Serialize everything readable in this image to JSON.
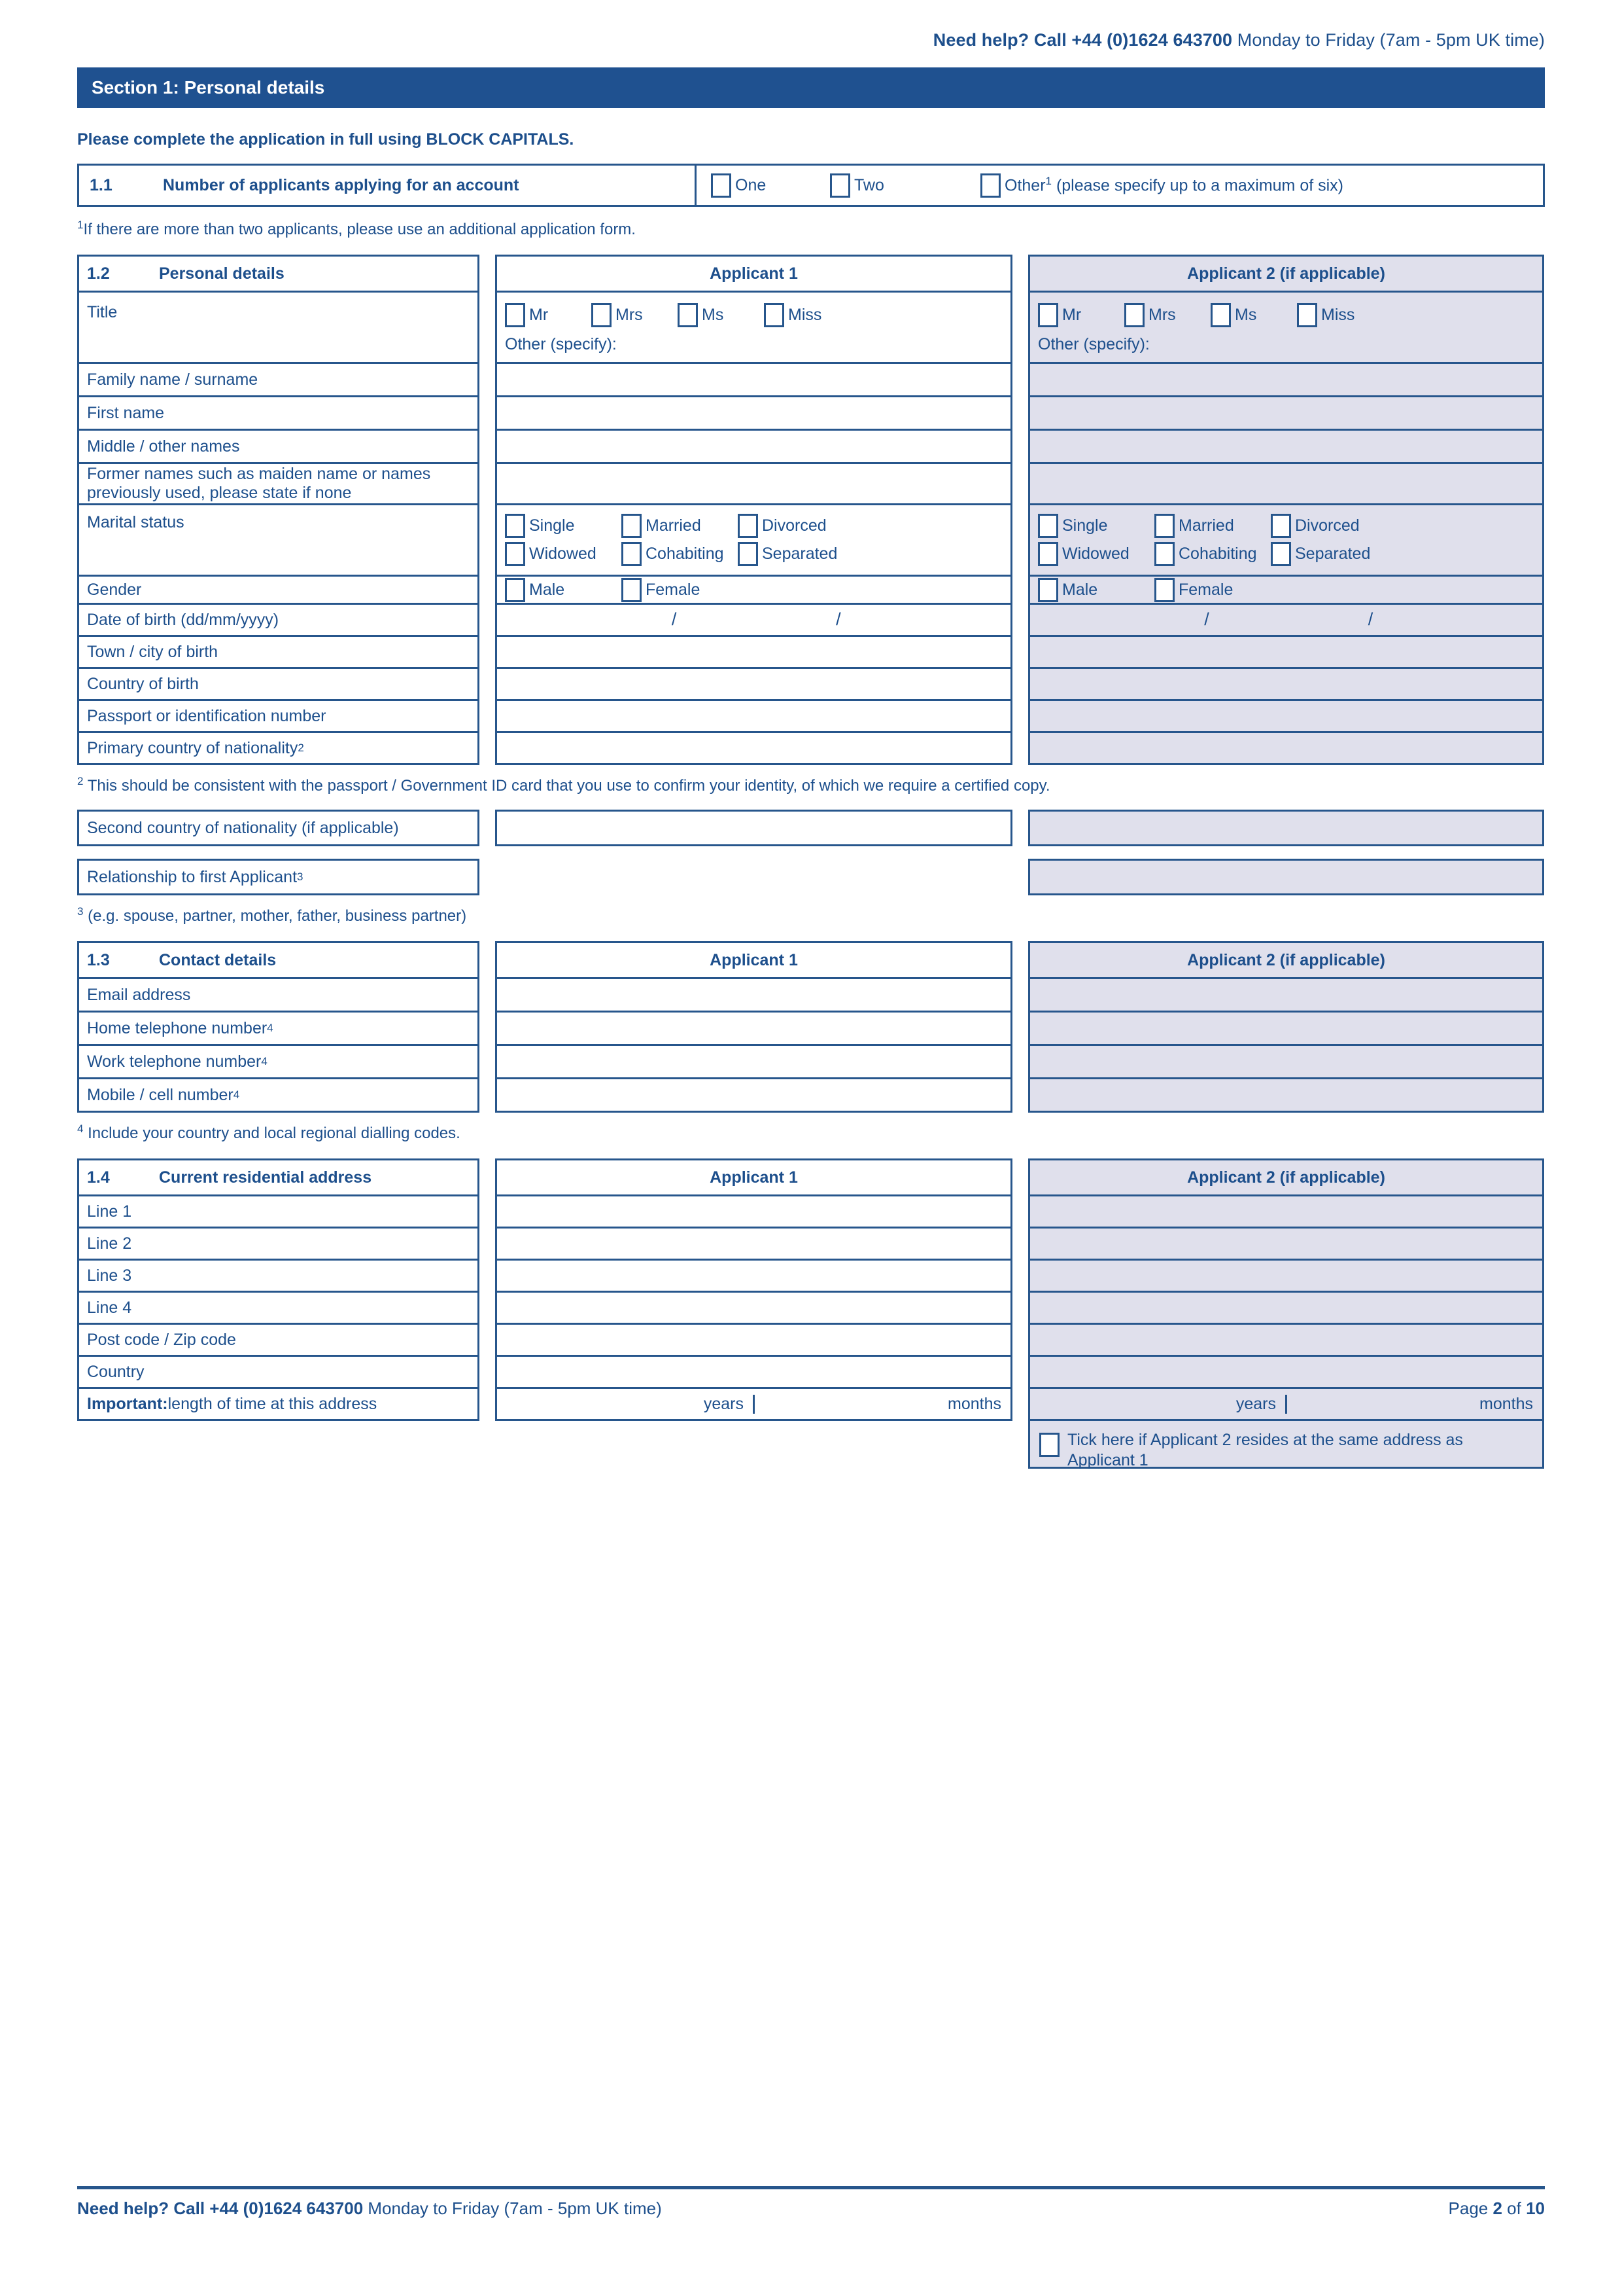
{
  "header": {
    "help_bold": "Need help? Call  +44 (0)1624 643700",
    "help_rest": " Monday to Friday (7am - 5pm UK time)"
  },
  "section": {
    "title": "Section 1: Personal details",
    "instruction": "Please complete the application in full using BLOCK CAPITALS."
  },
  "q11": {
    "number": "1.1",
    "label": "Number of applicants applying for an account",
    "options": [
      "One",
      "Two"
    ],
    "other_label": "Other",
    "other_sup": "1",
    "other_rest": "(please specify up to a maximum of six)",
    "footnote": "If there are more than two applicants, please use an additional application form.",
    "footnote_sup": "1"
  },
  "q12": {
    "number": "1.2",
    "label": "Personal details",
    "col2": "Applicant 1",
    "col3": "Applicant 2 (if applicable)",
    "title_label": "Title",
    "title_options": [
      "Mr",
      "Mrs",
      "Ms",
      "Miss"
    ],
    "other_specify": "Other (specify):",
    "rows": [
      "Family name / surname",
      "First name",
      "Middle / other names"
    ],
    "former_names": "Former names such as maiden name or names previously used, please state if none",
    "marital_label": "Marital status",
    "marital_options_row1": [
      "Single",
      "Married",
      "Divorced"
    ],
    "marital_options_row2": [
      "Widowed",
      "Cohabiting",
      "Separated"
    ],
    "gender_label": "Gender",
    "gender_options": [
      "Male",
      "Female"
    ],
    "dob_label": "Date of birth (dd/mm/yyyy)",
    "dob_slash": "/",
    "rows2": [
      "Town / city of birth",
      "Country of birth",
      "Passport or identification number"
    ],
    "nationality_label": "Primary country of nationality",
    "nationality_sup": "2",
    "footnote2_sup": "2",
    "footnote2": "This should be consistent with the passport / Government ID card that you use to confirm your identity, of which we require a certified copy.",
    "second_nationality": "Second country of nationality (if applicable)",
    "relationship_label": "Relationship to first Applicant",
    "relationship_sup": "3",
    "footnote3_sup": "3",
    "footnote3": "(e.g. spouse, partner, mother, father, business partner)"
  },
  "q13": {
    "number": "1.3",
    "label": "Contact details",
    "col2": "Applicant 1",
    "col3": "Applicant 2 (if applicable)",
    "rows": [
      {
        "label": "Email address",
        "sup": ""
      },
      {
        "label": "Home telephone number",
        "sup": "4"
      },
      {
        "label": "Work telephone number",
        "sup": "4"
      },
      {
        "label": "Mobile / cell number",
        "sup": "4"
      }
    ],
    "footnote4_sup": "4",
    "footnote4": "Include your country and local regional dialling codes."
  },
  "q14": {
    "number": "1.4",
    "label": "Current residential address",
    "col2": "Applicant 1",
    "col3": "Applicant 2 (if applicable)",
    "rows": [
      "Line 1",
      "Line 2",
      "Line 3",
      "Line 4",
      "Post code / Zip code",
      "Country"
    ],
    "important_bold": "Important:",
    "important_rest": " length of time at this address",
    "years": "years",
    "months": "months",
    "tick_text": "Tick here if Applicant 2 resides at the same address as Applicant 1"
  },
  "footer": {
    "help_bold": "Need help? Call  +44 (0)1624 643700",
    "help_rest": " Monday to Friday (7am - 5pm UK time)",
    "page_pre": "Page ",
    "page_num": "2",
    "page_mid": " of ",
    "page_total": "10"
  },
  "colors": {
    "navy": "#1f5190",
    "border": "#27568c",
    "shade": "#e0e0ec"
  }
}
